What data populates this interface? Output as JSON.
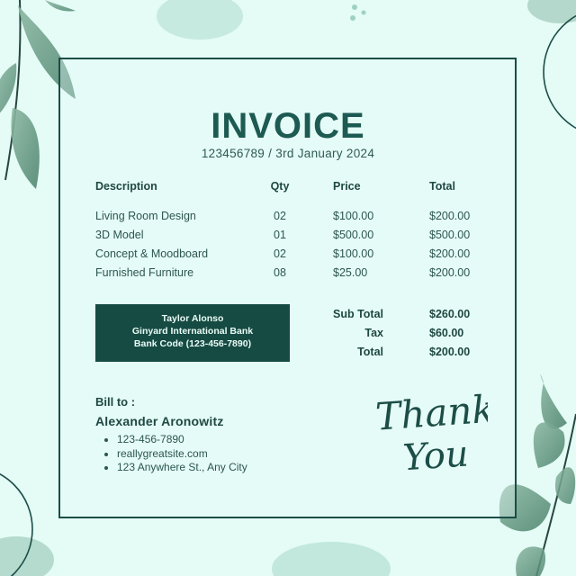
{
  "invoice": {
    "title": "INVOICE",
    "number_date": "123456789 / 3rd January 2024"
  },
  "table": {
    "headers": {
      "description": "Description",
      "qty": "Qty",
      "price": "Price",
      "total": "Total"
    },
    "rows": [
      {
        "description": "Living Room Design",
        "qty": "02",
        "price": "$100.00",
        "total": "$200.00"
      },
      {
        "description": "3D Model",
        "qty": "01",
        "price": "$500.00",
        "total": "$500.00"
      },
      {
        "description": "Concept & Moodboard",
        "qty": "02",
        "price": "$100.00",
        "total": "$200.00"
      },
      {
        "description": "Furnished Furniture",
        "qty": "08",
        "price": "$25.00",
        "total": "$200.00"
      }
    ]
  },
  "bank": {
    "name": "Taylor Alonso",
    "bank_name": "Ginyard International Bank",
    "bank_code": "Bank Code (123-456-7890)"
  },
  "summary": {
    "subtotal_label": "Sub Total",
    "subtotal_value": "$260.00",
    "tax_label": "Tax",
    "tax_value": "$60.00",
    "total_label": "Total",
    "total_value": "$200.00"
  },
  "bill_to": {
    "label": "Bill to :",
    "name": "Alexander Aronowitz",
    "phone": "123-456-7890",
    "website": "reallygreatsite.com",
    "address": "123 Anywhere St., Any City"
  },
  "thank_you": {
    "line1": "Thank",
    "line2": "You"
  },
  "colors": {
    "background": "#e4fbf6",
    "accent": "#164b43",
    "leaf": "#6f9f8a"
  }
}
